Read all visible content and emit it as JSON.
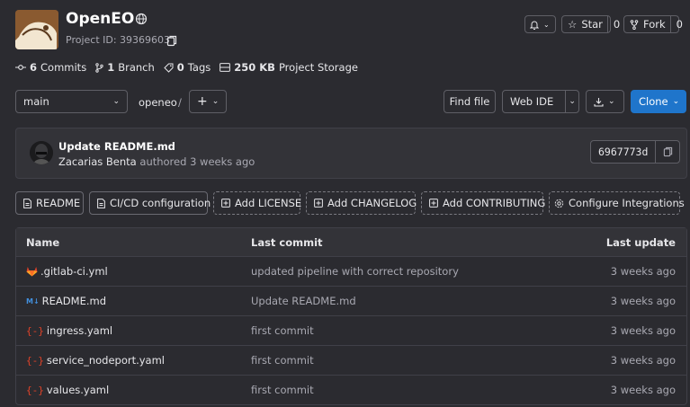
{
  "project": {
    "name": "OpenEO",
    "project_id": "Project ID: 39369603",
    "visibility_icon": "globe-icon",
    "copy_icon": "copy-icon"
  },
  "header_actions": {
    "notifications_icon": "bell-icon",
    "star_label": "Star",
    "star_count": "0",
    "fork_label": "Fork",
    "fork_count": "0"
  },
  "stats": {
    "commits_num": "6",
    "commits_label": "Commits",
    "branch_num": "1",
    "branch_label": "Branch",
    "tags_num": "0",
    "tags_label": "Tags",
    "storage_num": "250 KB",
    "storage_label": "Project Storage"
  },
  "toolbar": {
    "branch": "main",
    "path": "openeo",
    "path_sep": "/",
    "add_label": "+",
    "find_file": "Find file",
    "web_ide": "Web IDE",
    "clone": "Clone"
  },
  "last_commit": {
    "title": "Update README.md",
    "author": "Zacarias Benta",
    "when": "authored 3 weeks ago",
    "sha": "6967773d"
  },
  "quick_links": [
    {
      "label": "README",
      "style": "solid"
    },
    {
      "label": "CI/CD configuration",
      "style": "solid"
    },
    {
      "label": "Add LICENSE",
      "style": "dashed"
    },
    {
      "label": "Add CHANGELOG",
      "style": "dashed"
    },
    {
      "label": "Add CONTRIBUTING",
      "style": "dashed"
    },
    {
      "label": "Configure Integrations",
      "style": "dashed"
    }
  ],
  "file_table": {
    "headers": {
      "name": "Name",
      "last_commit": "Last commit",
      "last_update": "Last update"
    },
    "rows": [
      {
        "name": ".gitlab-ci.yml",
        "icon": "gitlab-icon",
        "commit": "updated pipeline with correct repository",
        "updated": "3 weeks ago"
      },
      {
        "name": "README.md",
        "icon": "markdown-icon",
        "commit": "Update README.md",
        "updated": "3 weeks ago"
      },
      {
        "name": "ingress.yaml",
        "icon": "yaml-icon",
        "commit": "first commit",
        "updated": "3 weeks ago"
      },
      {
        "name": "service_nodeport.yaml",
        "icon": "yaml-icon",
        "commit": "first commit",
        "updated": "3 weeks ago"
      },
      {
        "name": "values.yaml",
        "icon": "yaml-icon",
        "commit": "first commit",
        "updated": "3 weeks ago"
      }
    ]
  },
  "colors": {
    "background": "#2b2b30",
    "clone_button": "#1f75cb",
    "gitlab_orange": "#e24329",
    "markdown_blue": "#428fdc"
  }
}
